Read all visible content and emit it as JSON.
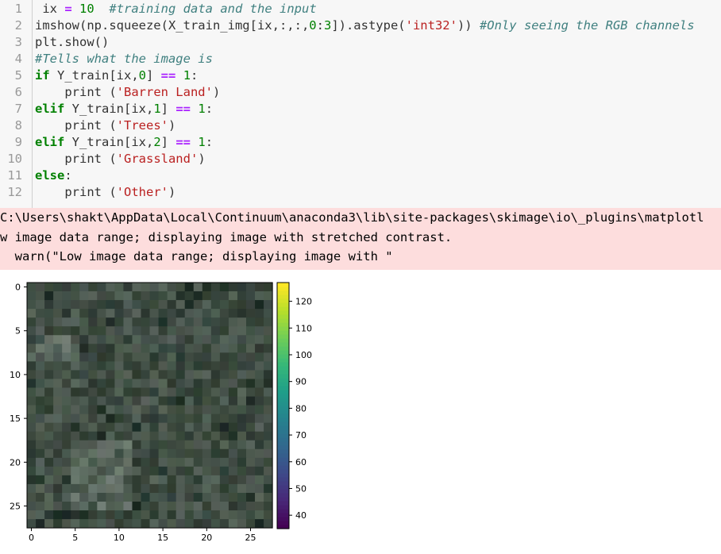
{
  "code_cell": {
    "lines": [
      {
        "n": "1",
        "segments": [
          {
            "t": " ix ",
            "c": ""
          },
          {
            "t": "=",
            "c": "op"
          },
          {
            "t": " ",
            "c": ""
          },
          {
            "t": "10",
            "c": "num"
          },
          {
            "t": "  ",
            "c": ""
          },
          {
            "t": "#training data and the input",
            "c": "cmt"
          }
        ]
      },
      {
        "n": "2",
        "segments": [
          {
            "t": "imshow(np.squeeze(X_train_img[ix,:,:,",
            "c": ""
          },
          {
            "t": "0",
            "c": "num"
          },
          {
            "t": ":",
            "c": ""
          },
          {
            "t": "3",
            "c": "num"
          },
          {
            "t": "]).astype(",
            "c": ""
          },
          {
            "t": "'int32'",
            "c": "str"
          },
          {
            "t": ")) ",
            "c": ""
          },
          {
            "t": "#Only seeing the RGB channels",
            "c": "cmt"
          }
        ]
      },
      {
        "n": "3",
        "segments": [
          {
            "t": "plt.show()",
            "c": ""
          }
        ]
      },
      {
        "n": "4",
        "segments": [
          {
            "t": "#Tells what the image is",
            "c": "cmt"
          }
        ]
      },
      {
        "n": "5",
        "segments": [
          {
            "t": "if",
            "c": "kw"
          },
          {
            "t": " Y_train[ix,",
            "c": ""
          },
          {
            "t": "0",
            "c": "num"
          },
          {
            "t": "] ",
            "c": ""
          },
          {
            "t": "==",
            "c": "op"
          },
          {
            "t": " ",
            "c": ""
          },
          {
            "t": "1",
            "c": "num"
          },
          {
            "t": ":",
            "c": ""
          }
        ]
      },
      {
        "n": "6",
        "segments": [
          {
            "t": "    print (",
            "c": ""
          },
          {
            "t": "'Barren Land'",
            "c": "str"
          },
          {
            "t": ")",
            "c": ""
          }
        ]
      },
      {
        "n": "7",
        "segments": [
          {
            "t": "elif",
            "c": "kw"
          },
          {
            "t": " Y_train[ix,",
            "c": ""
          },
          {
            "t": "1",
            "c": "num"
          },
          {
            "t": "] ",
            "c": ""
          },
          {
            "t": "==",
            "c": "op"
          },
          {
            "t": " ",
            "c": ""
          },
          {
            "t": "1",
            "c": "num"
          },
          {
            "t": ":",
            "c": ""
          }
        ]
      },
      {
        "n": "8",
        "segments": [
          {
            "t": "    print (",
            "c": ""
          },
          {
            "t": "'Trees'",
            "c": "str"
          },
          {
            "t": ")",
            "c": ""
          }
        ]
      },
      {
        "n": "9",
        "segments": [
          {
            "t": "elif",
            "c": "kw"
          },
          {
            "t": " Y_train[ix,",
            "c": ""
          },
          {
            "t": "2",
            "c": "num"
          },
          {
            "t": "] ",
            "c": ""
          },
          {
            "t": "==",
            "c": "op"
          },
          {
            "t": " ",
            "c": ""
          },
          {
            "t": "1",
            "c": "num"
          },
          {
            "t": ":",
            "c": ""
          }
        ]
      },
      {
        "n": "10",
        "segments": [
          {
            "t": "    print (",
            "c": ""
          },
          {
            "t": "'Grassland'",
            "c": "str"
          },
          {
            "t": ")",
            "c": ""
          }
        ]
      },
      {
        "n": "11",
        "segments": [
          {
            "t": "else",
            "c": "kw"
          },
          {
            "t": ":",
            "c": ""
          }
        ]
      },
      {
        "n": "12",
        "segments": [
          {
            "t": "    print (",
            "c": ""
          },
          {
            "t": "'Other'",
            "c": "str"
          },
          {
            "t": ")",
            "c": ""
          }
        ]
      }
    ]
  },
  "stderr": {
    "lines": [
      "C:\\Users\\shakt\\AppData\\Local\\Continuum\\anaconda3\\lib\\site-packages\\skimage\\io\\_plugins\\matplotl",
      "w image data range; displaying image with stretched contrast.",
      "  warn(\"Low image data range; displaying image with \""
    ]
  },
  "figure": {
    "image_axis": {
      "x_ticks": [
        "0",
        "5",
        "10",
        "15",
        "20",
        "25"
      ],
      "y_ticks": [
        "0",
        "5",
        "10",
        "15",
        "20",
        "25"
      ],
      "grid_size": 28
    },
    "colorbar": {
      "ticks": [
        "40",
        "50",
        "60",
        "70",
        "80",
        "90",
        "100",
        "110",
        "120"
      ],
      "range": [
        35,
        127
      ],
      "colormap": "viridis"
    }
  }
}
